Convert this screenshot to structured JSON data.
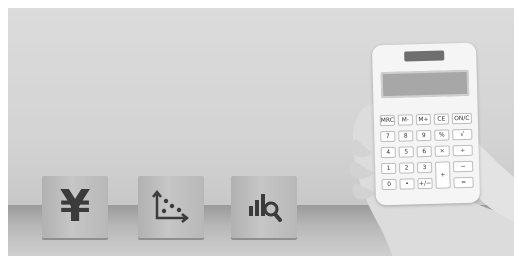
{
  "blocks": [
    {
      "icon": "yen-icon",
      "glyph": "¥"
    },
    {
      "icon": "scatter-chart-icon"
    },
    {
      "icon": "chart-magnifier-icon"
    }
  ],
  "calculator": {
    "keys": [
      [
        "MRC",
        "M-",
        "M+",
        "CE",
        "ON/C"
      ],
      [
        "7",
        "8",
        "9",
        "%",
        "√"
      ],
      [
        "4",
        "5",
        "6",
        "×",
        "÷"
      ],
      [
        "1",
        "2",
        "3",
        "+",
        "−"
      ],
      [
        "0",
        "•",
        "+/−",
        "",
        "="
      ]
    ]
  }
}
